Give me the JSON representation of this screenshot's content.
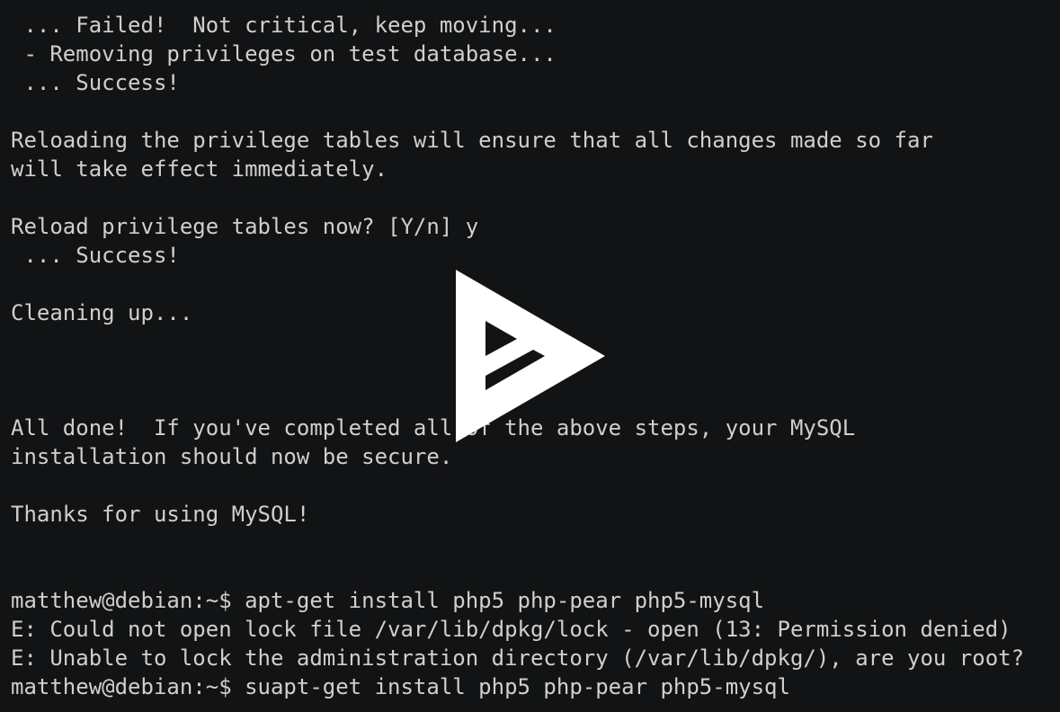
{
  "terminal": {
    "lines": [
      " ... Failed!  Not critical, keep moving...",
      " - Removing privileges on test database...",
      " ... Success!",
      "",
      "Reloading the privilege tables will ensure that all changes made so far",
      "will take effect immediately.",
      "",
      "Reload privilege tables now? [Y/n] y",
      " ... Success!",
      "",
      "Cleaning up...",
      "",
      "",
      "",
      "All done!  If you've completed all of the above steps, your MySQL",
      "installation should now be secure.",
      "",
      "Thanks for using MySQL!",
      "",
      "",
      "matthew@debian:~$ apt-get install php5 php-pear php5-mysql",
      "E: Could not open lock file /var/lib/dpkg/lock - open (13: Permission denied)",
      "E: Unable to lock the administration directory (/var/lib/dpkg/), are you root?",
      "matthew@debian:~$ suapt-get install php5 php-pear php5-mysql"
    ]
  },
  "overlay": {
    "icon": "asciinema-play-icon",
    "color": "#ffffff"
  },
  "colors": {
    "background": "#121314",
    "text": "#cfcfcf"
  }
}
